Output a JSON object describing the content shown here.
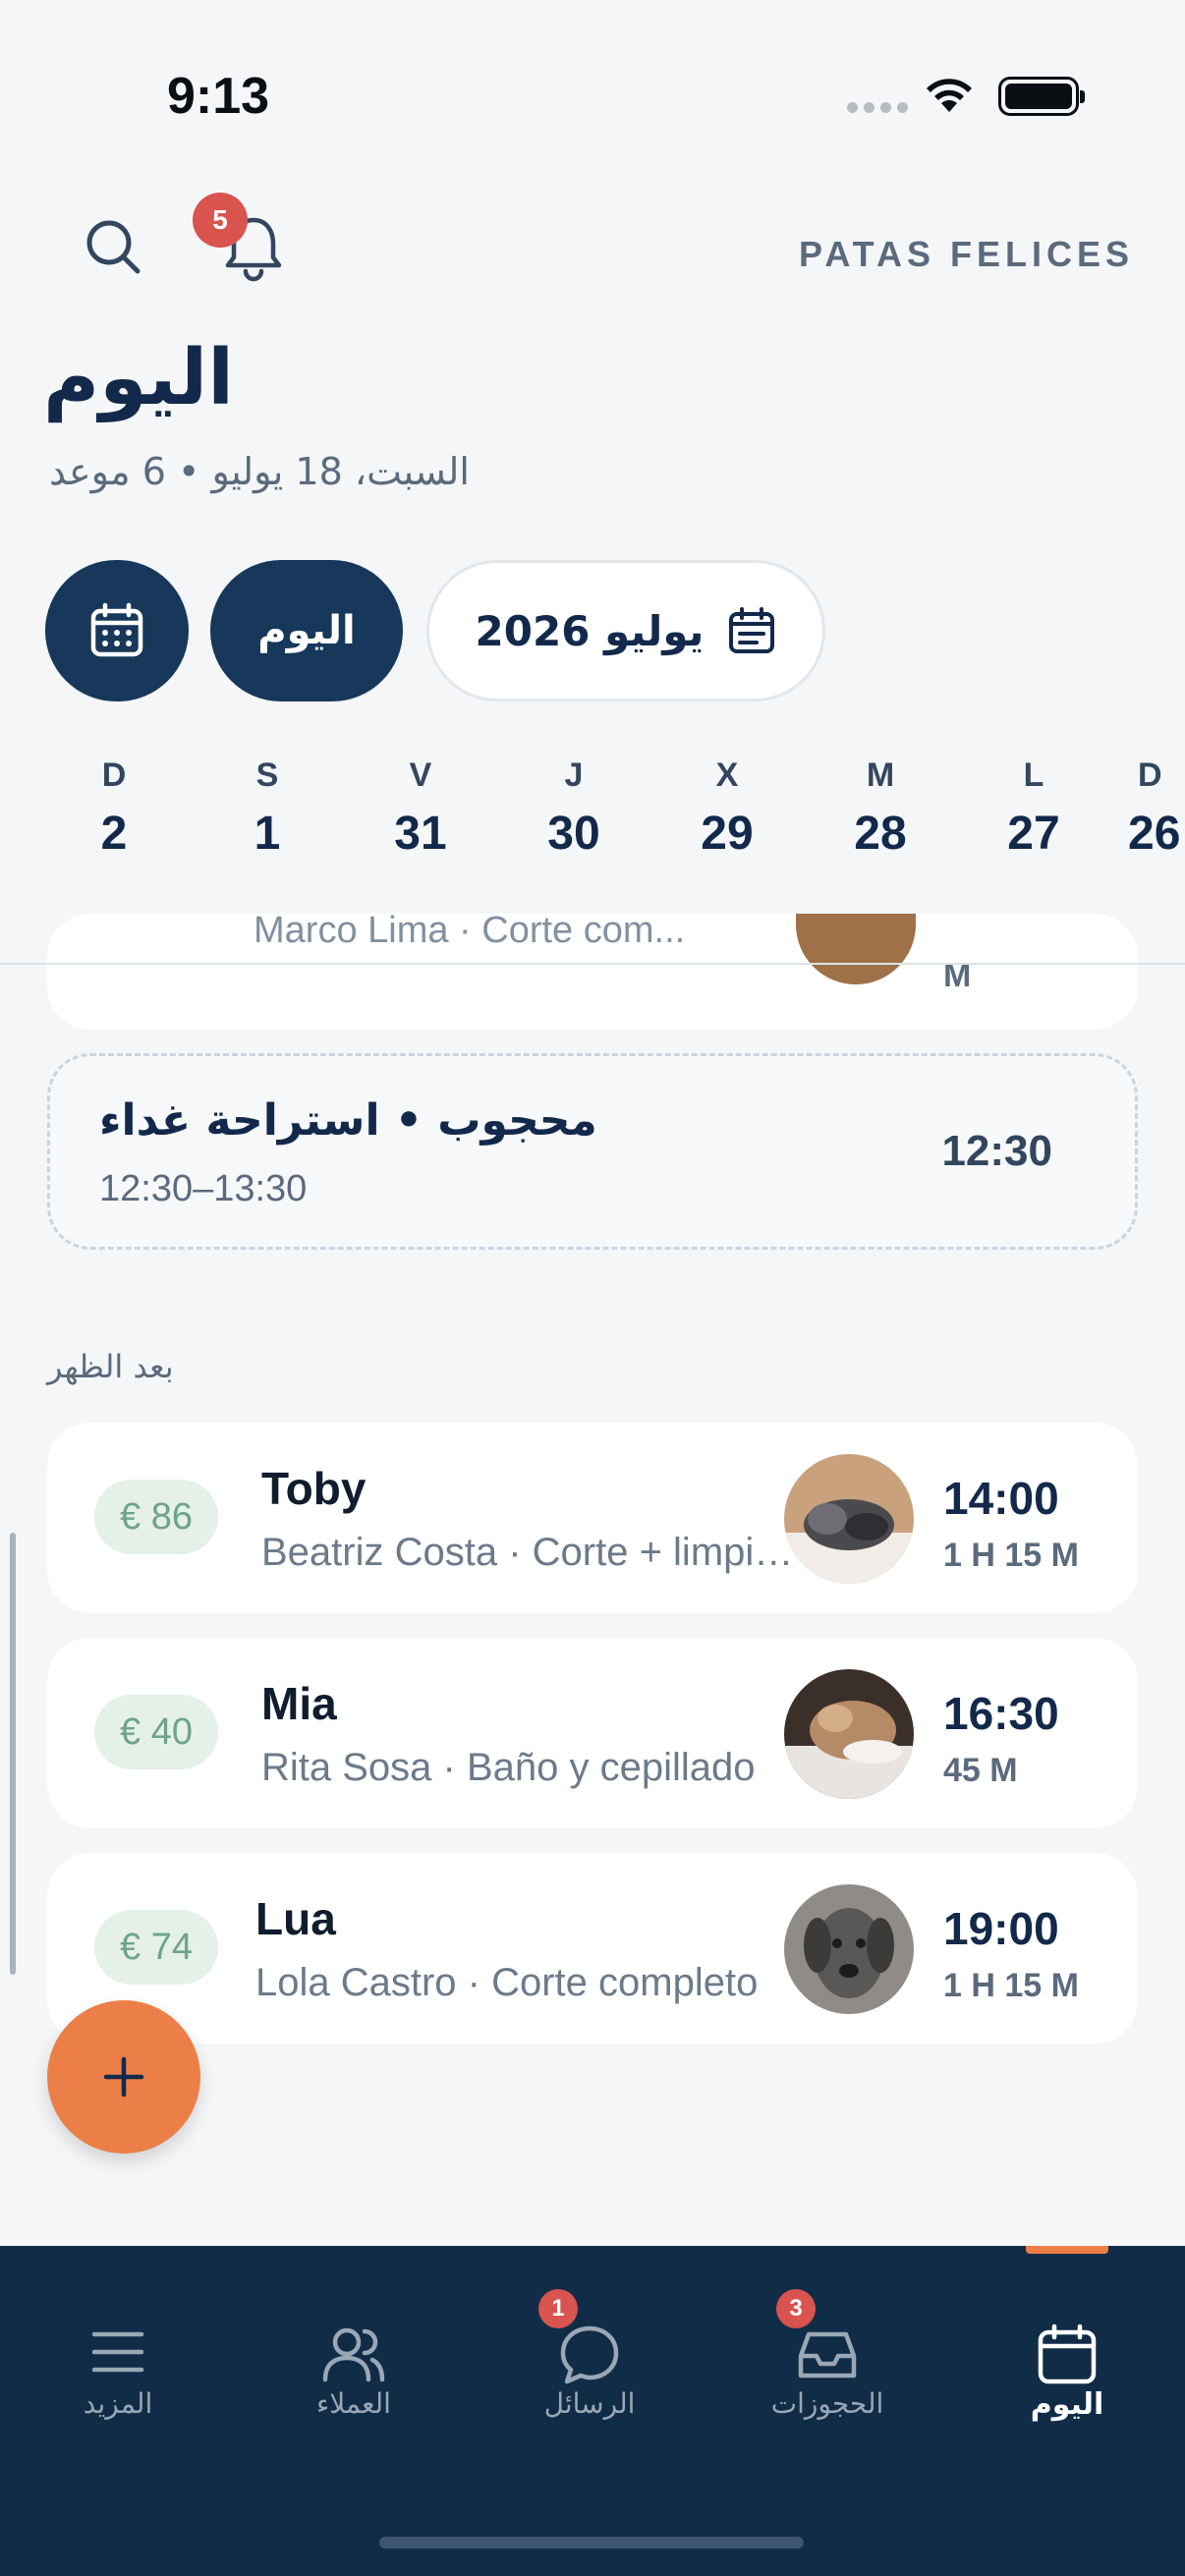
{
  "status_bar": {
    "time": "9:13"
  },
  "header": {
    "brand": "PATAS FELICES",
    "notification_count": "5",
    "title": "اليوم",
    "subtitle": "السبت، 18 يوليو • 6 موعد"
  },
  "controls": {
    "today_label": "اليوم",
    "month_label": "يوليو 2026"
  },
  "day_strip": [
    {
      "letter": "D",
      "number": "2"
    },
    {
      "letter": "S",
      "number": "1"
    },
    {
      "letter": "V",
      "number": "31"
    },
    {
      "letter": "J",
      "number": "30"
    },
    {
      "letter": "X",
      "number": "29"
    },
    {
      "letter": "M",
      "number": "28"
    },
    {
      "letter": "L",
      "number": "27"
    },
    {
      "letter": "D",
      "number": "26"
    }
  ],
  "partial_card": {
    "detail": "Marco Lima · Corte com...",
    "duration": "M"
  },
  "blocked": {
    "title": "محجوب • استراحة غداء",
    "time_range": "12:30–13:30",
    "start": "12:30"
  },
  "section_afternoon": "بعد الظهر",
  "appointments": [
    {
      "price": "€ 86",
      "pet": "Toby",
      "detail": "Beatriz Costa · Corte + limpieza",
      "time": "14:00",
      "duration": "1 H 15 M"
    },
    {
      "price": "€ 40",
      "pet": "Mia",
      "detail": "Rita Sosa · Baño y cepillado",
      "time": "16:30",
      "duration": "45 M"
    },
    {
      "price": "€ 74",
      "pet": "Lua",
      "detail": "Lola Castro · Corte completo",
      "time": "19:00",
      "duration": "1 H 15 M"
    }
  ],
  "bottom_nav": {
    "more": "المزيد",
    "clients": "العملاء",
    "messages": "الرسائل",
    "messages_badge": "1",
    "bookings": "الحجوزات",
    "bookings_badge": "3",
    "today": "اليوم"
  },
  "colors": {
    "primary": "#17385a",
    "accent": "#ec7f48",
    "nav_bg": "#112c47",
    "price_bg": "#e4f0e8",
    "badge": "#d9534f"
  }
}
